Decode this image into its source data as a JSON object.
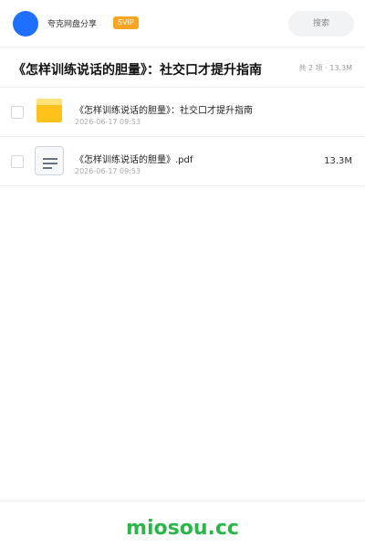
{
  "header": {
    "app_name": "夸克网盘分享",
    "badge": "SVIP",
    "search_placeholder": "搜索",
    "avatar_color": "#1f6fff",
    "badge_color": "#f6a623"
  },
  "share": {
    "title": "《怎样训练说话的胆量》：社交口才提升指南",
    "summary": "共 2 项 · 13.3M"
  },
  "files": [
    {
      "type": "folder",
      "icon": "folder-icon",
      "name": "《怎样训练说话的胆量》：社交口才提升指南",
      "date": "2026-06-17 09:53",
      "size": ""
    },
    {
      "type": "pdf",
      "icon": "document-icon",
      "name": "《怎样训练说话的胆量》.pdf",
      "date": "2026-06-17 09:53",
      "size": "13.3M"
    }
  ],
  "footer": {
    "brand": "miosou.cc",
    "brand_color": "#2bb64a"
  }
}
